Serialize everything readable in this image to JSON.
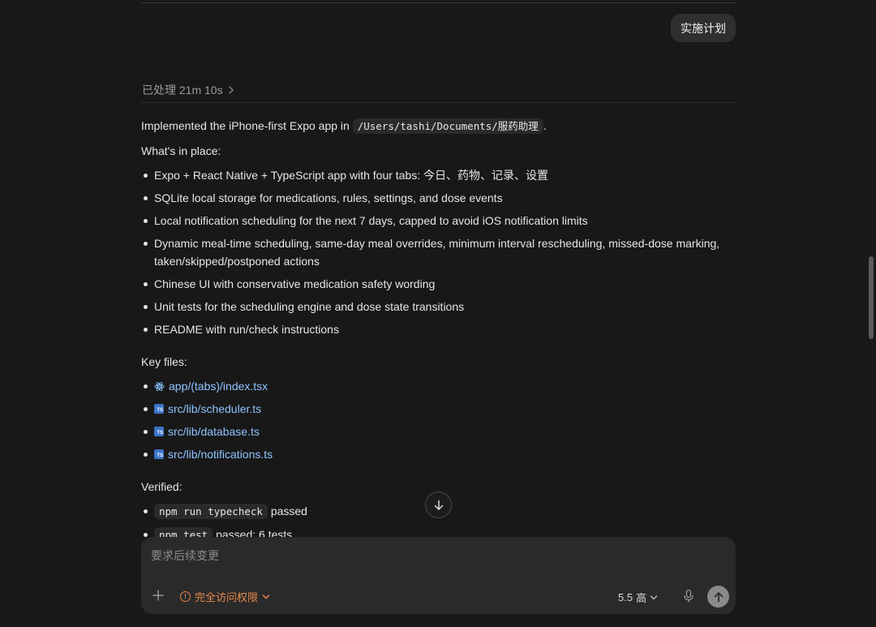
{
  "user_message": {
    "text": "实施计划"
  },
  "status": {
    "label": "已处理 21m 10s",
    "chevron": "chevron-right-icon"
  },
  "response": {
    "intro_prefix": "Implemented the iPhone-first Expo app in ",
    "intro_path": "/Users/tashi/Documents/服药助理",
    "intro_suffix": ".",
    "whats_in_place_heading": "What's in place:",
    "items": [
      "Expo + React Native + TypeScript app with four tabs: 今日、药物、记录、设置",
      "SQLite local storage for medications, rules, settings, and dose events",
      "Local notification scheduling for the next 7 days, capped to avoid iOS notification limits",
      "Dynamic meal-time scheduling, same-day meal overrides, minimum interval rescheduling, missed-dose marking, taken/skipped/postponed actions",
      "Chinese UI with conservative medication safety wording",
      "Unit tests for the scheduling engine and dose state transitions",
      "README with run/check instructions"
    ],
    "key_files_heading": "Key files:",
    "key_files": [
      {
        "name": "app/(tabs)/index.tsx",
        "icon": "react-icon"
      },
      {
        "name": "src/lib/scheduler.ts",
        "icon": "typescript-file-icon"
      },
      {
        "name": "src/lib/database.ts",
        "icon": "typescript-file-icon"
      },
      {
        "name": "src/lib/notifications.ts",
        "icon": "typescript-file-icon"
      }
    ],
    "verified_heading": "Verified:",
    "verified": [
      {
        "command": "npm run typecheck",
        "result": "passed"
      },
      {
        "command": "npm test",
        "result": "passed: 6 tests"
      }
    ]
  },
  "composer": {
    "placeholder": "要求后续变更",
    "access_label": "完全访问权限",
    "model_version": "5.5",
    "model_level": "高",
    "accent_color": "#e8884a"
  }
}
